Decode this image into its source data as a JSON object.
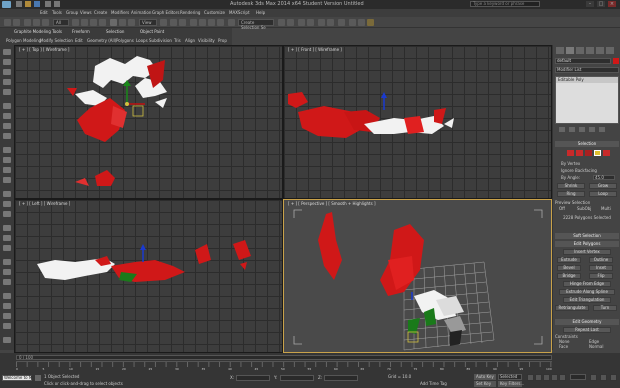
{
  "window": {
    "title": "Autodesk 3ds Max 2014 x64    Student Version    Untitled",
    "search_placeholder": "Type a keyword or phrase"
  },
  "menubar": {
    "items": [
      "Edit",
      "Tools",
      "Group",
      "Views",
      "Create",
      "Modifiers",
      "Animation",
      "Graph Editors",
      "Rendering",
      "Customize",
      "MAXScript",
      "Help"
    ]
  },
  "toolbar": {
    "selection_filter": "All",
    "view_dropdown": "View",
    "selection_set": "Create Selection Se"
  },
  "ribbon": {
    "tabs": [
      "Graphite Modeling Tools",
      "Freeform",
      "Selection",
      "Object Paint"
    ],
    "subtabs": [
      "Polygon Modeling",
      "Modify Selection",
      "Edit",
      "Geometry (All)",
      "Polygons",
      "Loops",
      "Subdivision",
      "Tris",
      "Align",
      "Visibility",
      "Prop"
    ]
  },
  "viewports": {
    "top": "[ + ] [ Top ] [ Wireframe ]",
    "front": "[ + ] [ Front ] [ Wireframe ]",
    "left": "[ + ] [ Left ] [ Wireframe ]",
    "perspective": "[ + ] [ Perspective ] [ Smooth + Highlights ]"
  },
  "command_panel": {
    "object_name": "default",
    "modifier_list": "Modifier List",
    "stack_item": "Editable Poly",
    "selection_header": "Selection",
    "by_vertex": "By Vertex",
    "ignore_backfacing": "Ignore Backfacing",
    "by_angle": "By Angle:",
    "by_angle_value": "45.0",
    "shrink": "Shrink",
    "grow": "Grow",
    "ring": "Ring",
    "loop": "Loop",
    "preview_selection": "Preview Selection",
    "preview_off": "Off",
    "preview_subobj": "SubObj",
    "preview_multi": "Multi",
    "selected_info": "2228 Polygons Selected",
    "soft_selection": "Soft Selection",
    "edit_polygons": "Edit Polygons",
    "insert_vertex": "Insert Vertex",
    "extrude": "Extrude",
    "outline": "Outline",
    "bevel": "Bevel",
    "inset": "Inset",
    "bridge": "Bridge",
    "flip": "Flip",
    "hinge_from_edge": "Hinge From Edge",
    "extrude_along_spline": "Extrude Along Spline",
    "edit_triangulation": "Edit Triangulation",
    "retriangulate": "Retriangulate",
    "turn": "Turn",
    "edit_geometry": "Edit Geometry",
    "repeat_last": "Repeat Last",
    "constraints": "Constraints",
    "c_none": "None",
    "c_edge": "Edge",
    "c_face": "Face",
    "c_normal": "Normal",
    "preserve_uvs": "Preserve UVs"
  },
  "timeline": {
    "frame_slider": "0 / 100",
    "tick_labels": [
      "0",
      "5",
      "10",
      "15",
      "20",
      "25",
      "30",
      "35",
      "40",
      "45",
      "50",
      "55",
      "60",
      "65",
      "70",
      "75",
      "80",
      "85",
      "90",
      "95",
      "100"
    ]
  },
  "statusbar": {
    "welcome": "Welcome to M",
    "selected": "1 Object Selected",
    "prompt": "Click or click-and-drag to select objects",
    "x_label": "X:",
    "y_label": "Y:",
    "z_label": "Z:",
    "grid": "Grid = 10.0",
    "add_time_tag": "Add Time Tag",
    "auto_key": "Auto Key",
    "set_key": "Set Key",
    "selected_dropdown": "Selected",
    "key_filters": "Key Filters..."
  },
  "colors": {
    "mesh_red": "#d01818",
    "mesh_white": "#f2f2f2",
    "active_border": "#c9a24a",
    "viewport_bg": "#3d3d3d"
  }
}
